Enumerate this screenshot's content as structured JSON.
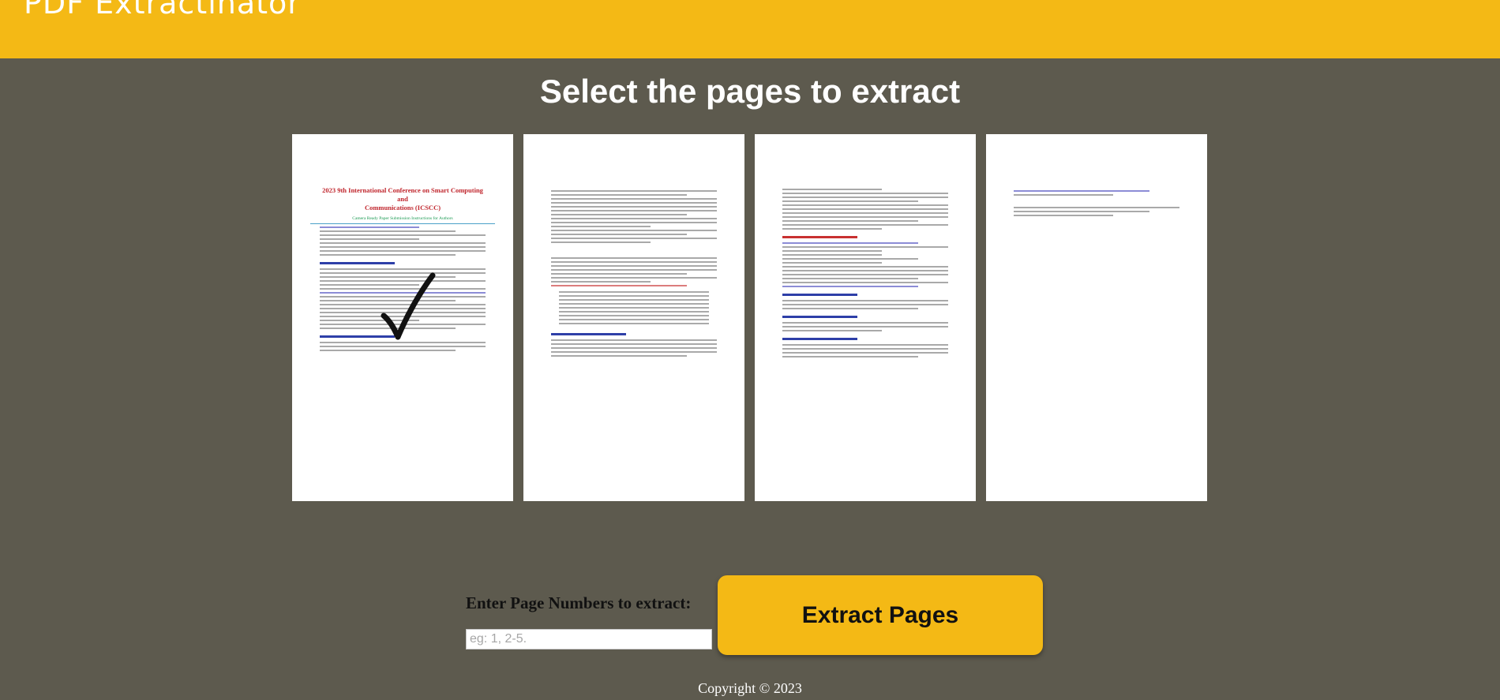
{
  "header": {
    "logo_text": "PDF Extractinator"
  },
  "main": {
    "title": "Select the pages to extract",
    "pages": [
      {
        "doc_title_line1": "2023 9th International Conference on Smart Computing and",
        "doc_title_line2": "Communications (ICSCC)",
        "doc_subtitle": "Camera Ready Paper Submission Instructions for Authors",
        "selected": true
      },
      {
        "selected": false
      },
      {
        "selected": false
      },
      {
        "selected": false
      }
    ]
  },
  "form": {
    "label": "Enter Page Numbers to extract:",
    "input_placeholder": "eg: 1, 2-5.",
    "input_value": "",
    "button_label": "Extract Pages"
  },
  "footer": {
    "copyright": "Copyright © 2023"
  },
  "colors": {
    "accent": "#f4b915",
    "background": "#5d5a4e"
  }
}
